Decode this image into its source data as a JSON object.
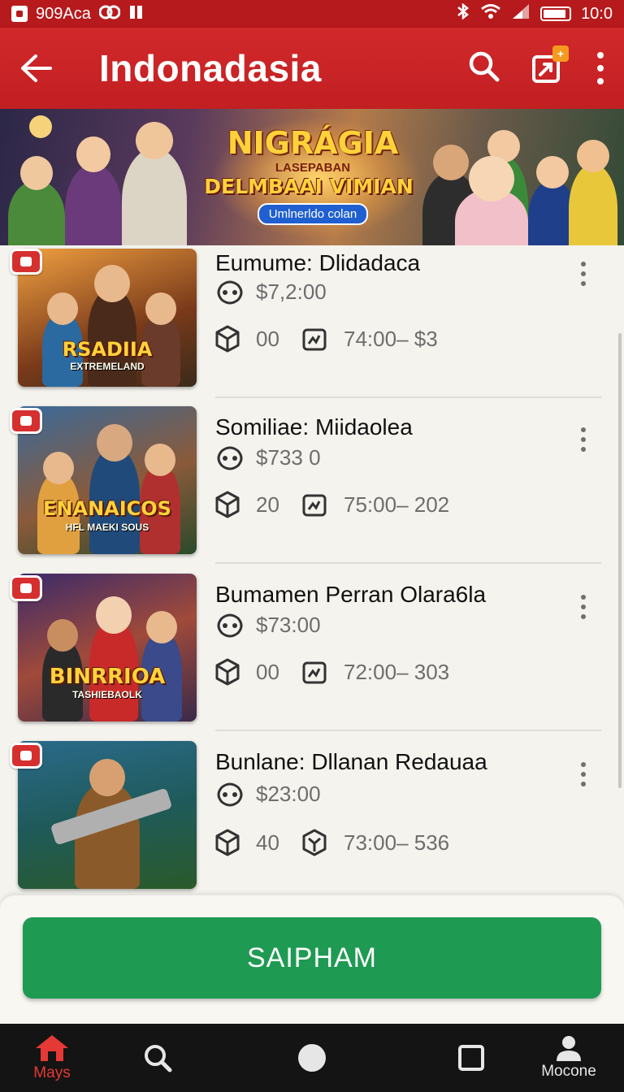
{
  "status_bar": {
    "carrier": "909Aca",
    "time": "10:0"
  },
  "app_bar": {
    "title": "Indonadasia",
    "badge": "+"
  },
  "banner": {
    "title_line1": "NIGRÁGIA",
    "title_line2": "LASEPABAN",
    "title_line3": "DELMBAAI VIMIAN",
    "pill": "Umlnerldo colan"
  },
  "games": [
    {
      "name": "Eumume: Dlidadaca",
      "price": "$7,2:00",
      "count": "00",
      "range": "74:00– $3",
      "logo": "RSADIIA",
      "logo_sub": "EXTREMELAND"
    },
    {
      "name": "Somiliae: Miidaolea",
      "price": "$733 0",
      "count": "20",
      "range": "75:00– 202",
      "logo": "ENANAICOS",
      "logo_sub": "HFL MAEKI SOUS"
    },
    {
      "name": "Bumamen Perran Olara6la",
      "price": "$73:00",
      "count": "00",
      "range": "72:00– 303",
      "logo": "BINRRIOA",
      "logo_sub": "TASHIEBAOLK"
    },
    {
      "name": "Bunlane: Dllanan Redauaa",
      "price": "$23:00",
      "count": "40",
      "range": "73:00– 536",
      "logo": "",
      "logo_sub": ""
    }
  ],
  "primary_action": {
    "label": "SAIPHAM"
  },
  "bottom_nav": [
    {
      "label": "Mays",
      "icon": "home-icon",
      "active": true
    },
    {
      "label": "",
      "icon": "search-icon",
      "active": false
    },
    {
      "label": "",
      "icon": "circle-home-icon",
      "active": false
    },
    {
      "label": "",
      "icon": "square-recents-icon",
      "active": false
    },
    {
      "label": "Mocone",
      "icon": "profile-icon",
      "active": false
    }
  ],
  "colors": {
    "primary_red": "#c21f22",
    "action_green": "#1f9a52",
    "nav_active": "#e53935"
  }
}
